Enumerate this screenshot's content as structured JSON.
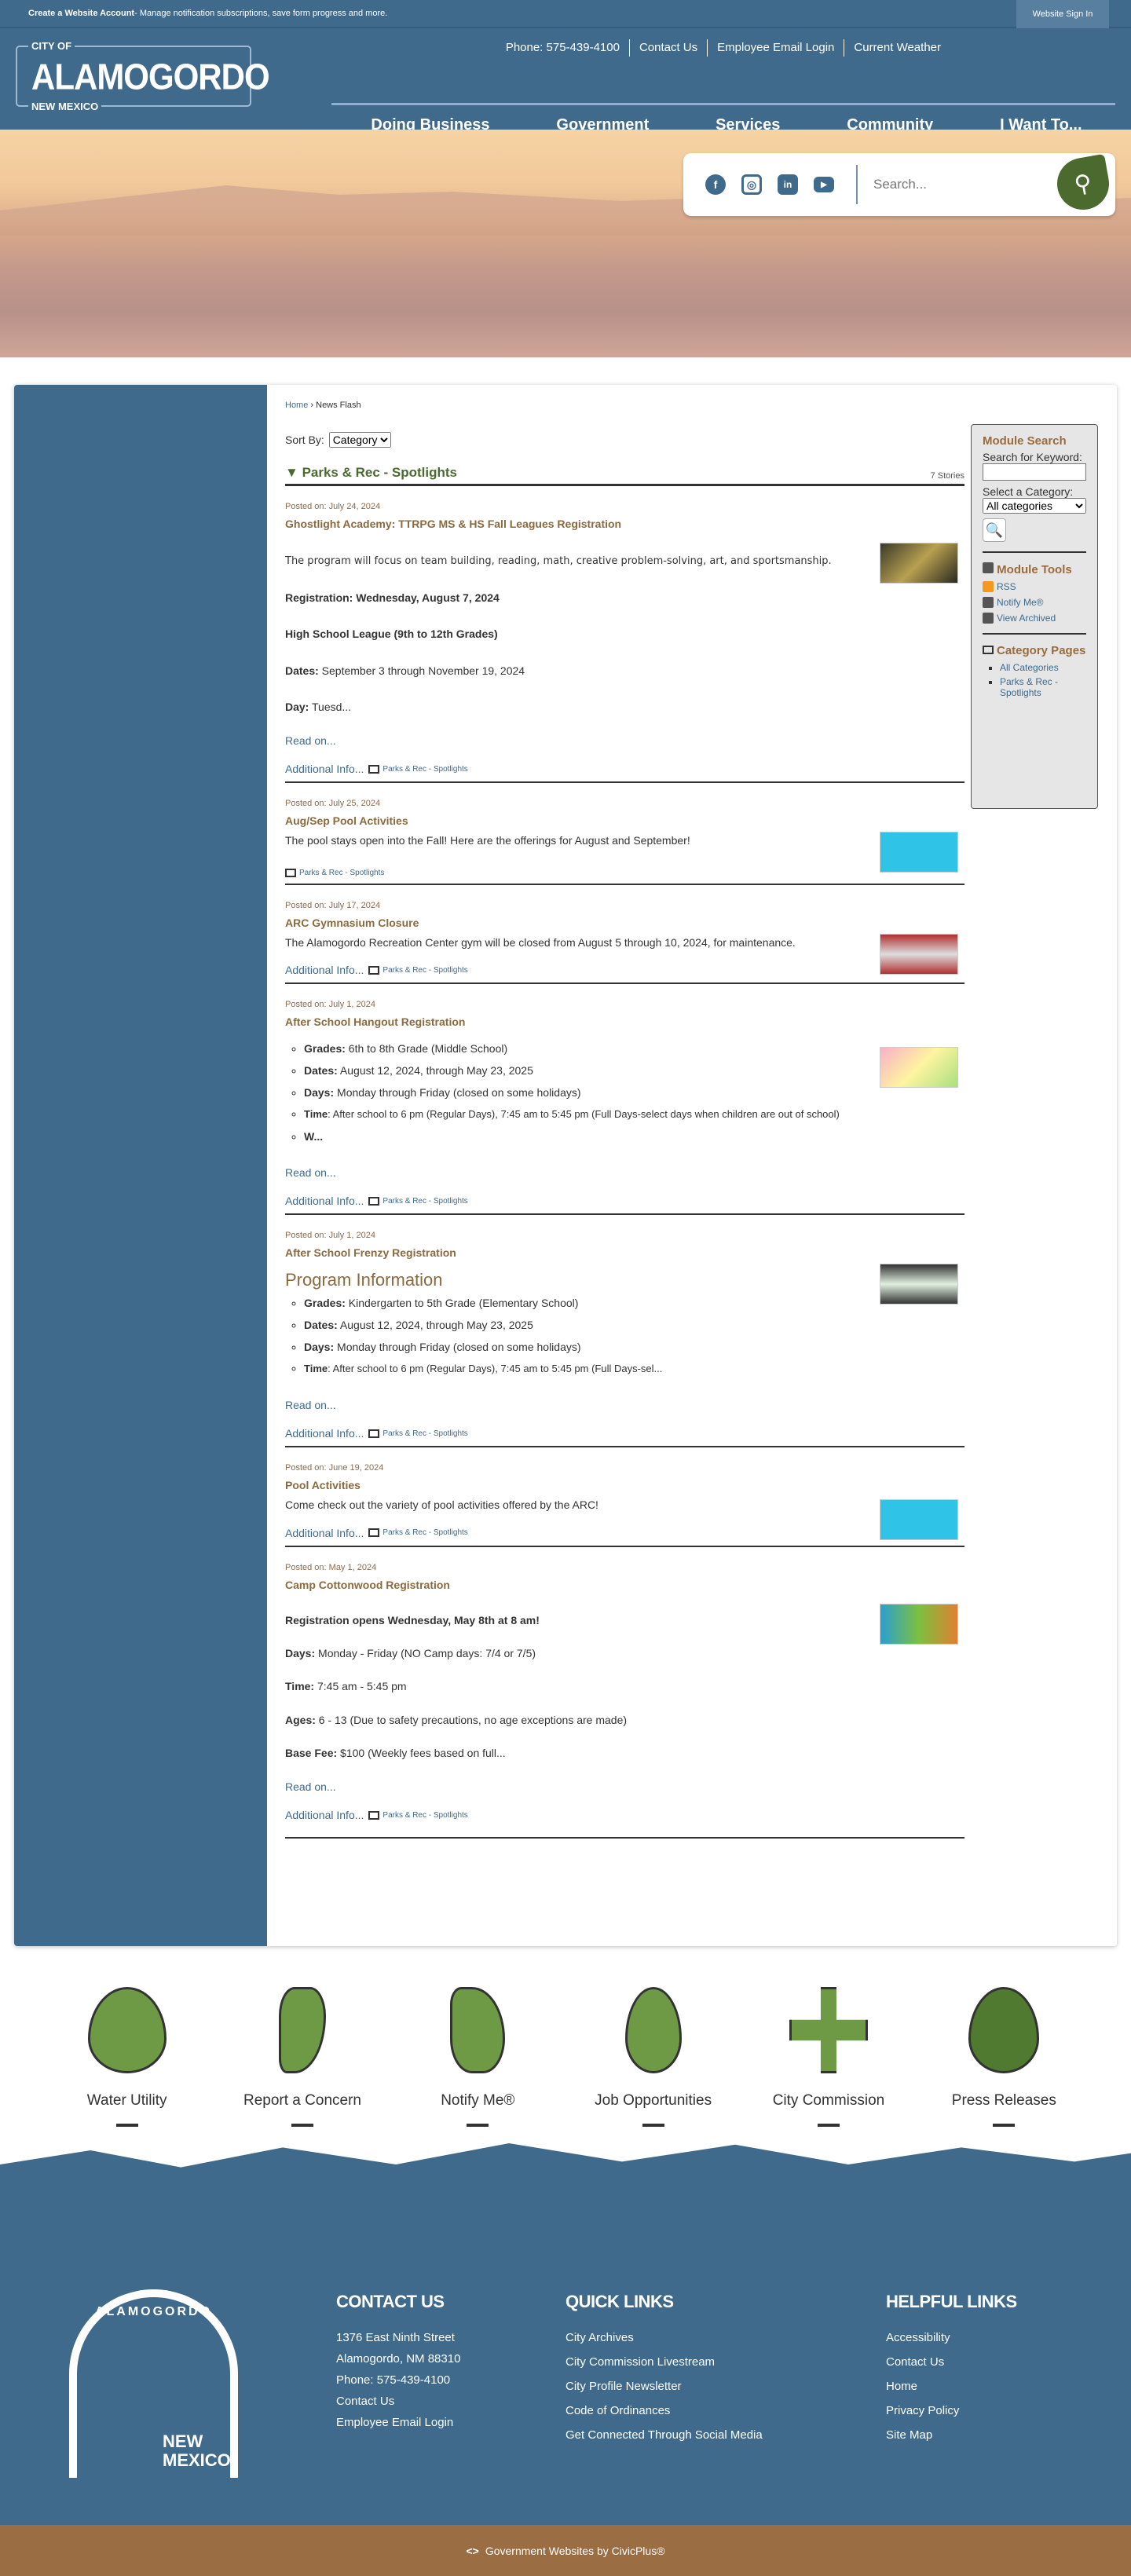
{
  "topbar": {
    "account_bold": "Create a Website Account",
    "account_text": " - Manage notification subscriptions, save form progress and more.",
    "sign_in": "Website Sign In"
  },
  "logo": {
    "city_of": "CITY OF",
    "name": "ALAMOGORDO",
    "state": "NEW MEXICO"
  },
  "utility": [
    "Phone: 575-439-4100",
    "Contact Us",
    "Employee Email Login",
    "Current Weather"
  ],
  "nav": [
    "Doing Business",
    "Government",
    "Services",
    "Community",
    "I Want To..."
  ],
  "search": {
    "placeholder": "Search...",
    "social": [
      "facebook",
      "instagram",
      "linkedin",
      "youtube"
    ]
  },
  "breadcrumb": {
    "home": "Home",
    "sep": " › ",
    "current": "News Flash"
  },
  "sort": {
    "label": "Sort By:",
    "value": "Category"
  },
  "category": {
    "title": "Parks & Rec - Spotlights",
    "count": "7 Stories",
    "arrow": "▼"
  },
  "labels": {
    "read_on": "Read on...",
    "additional": "Additional Info...",
    "cat": "Parks & Rec - Spotlights"
  },
  "articles": [
    {
      "posted": "Posted on: July 24, 2024",
      "title": "Ghostlight Academy: TTRPG MS & HS Fall Leagues Registration",
      "p1": "The program will focus on team building, reading, math, creative problem-solving, art, and sportsmanship.",
      "p2": "Registration: Wednesday, August 7, 2024",
      "p3": "High School League (9th to 12th Grades)",
      "p4k": "Dates:",
      "p4v": " September 3 through November 19, 2024",
      "p5k": "Day:",
      "p5v": " Tuesd..."
    },
    {
      "posted": "Posted on: July 25, 2024",
      "title": "Aug/Sep Pool Activities",
      "p1": "The pool stays open into the Fall! Here are the offerings for August and September!"
    },
    {
      "posted": "Posted on: July 17, 2024",
      "title": "ARC Gymnasium Closure",
      "p1": "The Alamogordo Recreation Center gym will be closed from August 5 through 10, 2024, for maintenance."
    },
    {
      "posted": "Posted on: July 1, 2024",
      "title": "After School Hangout Registration",
      "items": [
        {
          "k": "Grades:",
          "v": " 6th to 8th Grade (Middle School)"
        },
        {
          "k": "Dates:",
          "v": " August 12, 2024, through May 23, 2025"
        },
        {
          "k": "Days:",
          "v": " Monday through Friday (closed on some holidays)"
        },
        {
          "k": "Time",
          "v": ": After school to 6 pm (Regular Days), 7:45 am to 5:45 pm (Full Days-select days when children are out of school)"
        },
        {
          "k": "W...",
          "v": ""
        }
      ]
    },
    {
      "posted": "Posted on: July 1, 2024",
      "title": "After School Frenzy Registration",
      "heading": "Program Information",
      "items": [
        {
          "k": "Grades:",
          "v": " Kindergarten to 5th Grade (Elementary School)"
        },
        {
          "k": "Dates:",
          "v": " August 12, 2024, through May 23, 2025"
        },
        {
          "k": "Days:",
          "v": " Monday through Friday (closed on some holidays)"
        },
        {
          "k": "Time",
          "v": ": After school to 6 pm (Regular Days), 7:45 am to 5:45 pm (Full Days-sel..."
        }
      ]
    },
    {
      "posted": "Posted on: June 19, 2024",
      "title": "Pool Activities",
      "p1": "Come check out the variety of pool activities offered by the ARC!"
    },
    {
      "posted": "Posted on: May 1, 2024",
      "title": "Camp Cottonwood Registration",
      "p1": "Registration opens Wednesday, May 8th at 8 am!",
      "p2k": "Days:",
      "p2v": " Monday - Friday (NO Camp days: 7/4 or 7/5)",
      "p3k": "Time:",
      "p3v": " 7:45 am - 5:45 pm",
      "p4k": "Ages:",
      "p4v": " 6 - 13 (Due to safety precautions, no age exceptions are made)",
      "p5k": "Base Fee:",
      "p5v": " $100 (Weekly fees based on full..."
    }
  ],
  "module": {
    "search_title": "Module Search",
    "keyword_label": "Search for Keyword:",
    "category_label": "Select a Category:",
    "category_value": "All categories",
    "tools_title": "Module Tools",
    "tools": [
      "RSS",
      "Notify Me®",
      "View Archived"
    ],
    "pages_title": "Category Pages",
    "pages": [
      "All Categories",
      "Parks & Rec - Spotlights"
    ]
  },
  "quick_links": [
    "Water Utility",
    "Report a Concern",
    "Notify Me®",
    "Job Opportunities",
    "City Commission",
    "Press Releases"
  ],
  "footer": {
    "logo_top": "ALAMOGORDO",
    "logo_bottom": "NEW MEXICO",
    "contact": {
      "title": "CONTACT US",
      "lines": [
        "1376 East Ninth Street",
        "Alamogordo, NM 88310",
        "Phone:  575-439-4100",
        "Contact Us",
        "Employee Email Login"
      ]
    },
    "quick": {
      "title": "QUICK LINKS",
      "links": [
        "City Archives",
        "City Commission Livestream",
        "City Profile Newsletter",
        "Code of Ordinances",
        "Get Connected Through Social Media"
      ]
    },
    "helpful": {
      "title": "HELPFUL LINKS",
      "links": [
        "Accessibility",
        "Contact Us",
        "Home",
        "Privacy Policy",
        "Site Map"
      ]
    },
    "credit": "Government Websites by CivicPlus®"
  },
  "colors": {
    "brand_blue": "#3f6a8c",
    "green": "#4b6a2f",
    "brown": "#9a6d42",
    "title_brown": "#8a6a3e"
  }
}
